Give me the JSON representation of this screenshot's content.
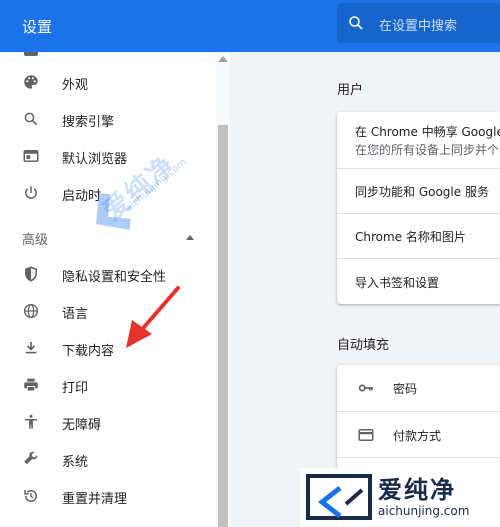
{
  "header": {
    "title": "设置",
    "search_placeholder": "在设置中搜索"
  },
  "sidebar": {
    "items_top": [
      {
        "label": "外观",
        "icon": "palette-icon"
      },
      {
        "label": "搜索引擎",
        "icon": "search-icon"
      },
      {
        "label": "默认浏览器",
        "icon": "browser-window-icon"
      },
      {
        "label": "启动时",
        "icon": "power-icon"
      }
    ],
    "advanced_label": "高级",
    "items_advanced": [
      {
        "label": "隐私设置和安全性",
        "icon": "shield-icon"
      },
      {
        "label": "语言",
        "icon": "globe-icon"
      },
      {
        "label": "下载内容",
        "icon": "download-icon"
      },
      {
        "label": "打印",
        "icon": "printer-icon"
      },
      {
        "label": "无障碍",
        "icon": "accessibility-icon"
      },
      {
        "label": "系统",
        "icon": "wrench-icon"
      },
      {
        "label": "重置并清理",
        "icon": "restore-icon"
      }
    ]
  },
  "main": {
    "people_section": "用户",
    "people_rows": {
      "sync_title": "在 Chrome 中畅享 Google 的",
      "sync_sub": "在您的所有设备上同步并个",
      "sync_services": "同步功能和 Google 服务",
      "chrome_name": "Chrome 名称和图片",
      "import": "导入书签和设置"
    },
    "autofill_section": "自动填充",
    "autofill_rows": {
      "passwords": "密码",
      "payments": "付款方式"
    }
  },
  "watermark": {
    "brand": "爱纯净",
    "url": "aichunjing.com"
  },
  "colors": {
    "accent": "#1a73e8",
    "arrow": "#e5322d"
  }
}
